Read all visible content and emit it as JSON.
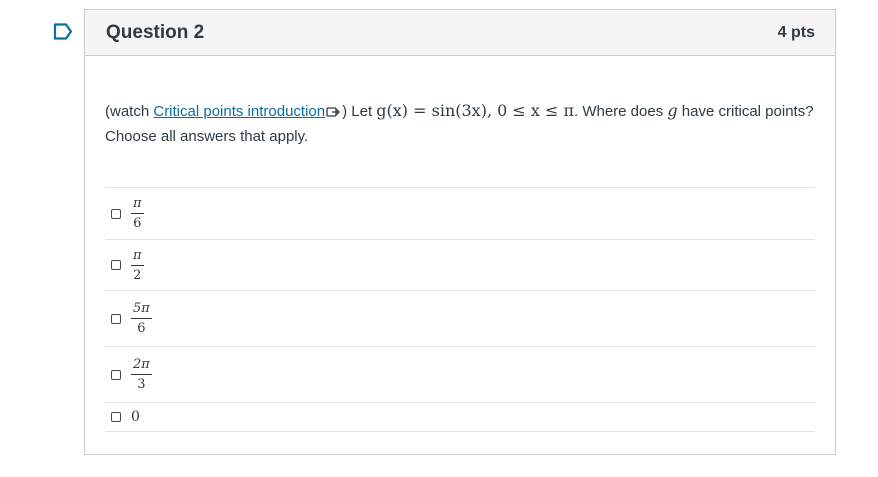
{
  "question": {
    "title": "Question 2",
    "points": "4 pts",
    "prompt_prefix": "(watch ",
    "link_text": "Critical points introduction",
    "prompt_middle": ") Let ",
    "math_expr": "g(x) = sin(3x), 0 ≤ x ≤ π",
    "prompt_after_math": ". Where does ",
    "math_var": "g",
    "prompt_suffix": " have critical points? Choose all answers that apply."
  },
  "answers": [
    {
      "numerator": "π",
      "denominator": "6",
      "checked": false
    },
    {
      "numerator": "π",
      "denominator": "2",
      "checked": false
    },
    {
      "numerator": "5π",
      "denominator": "6",
      "checked": false
    },
    {
      "numerator": "2π",
      "denominator": "3",
      "checked": false
    },
    {
      "plain": "0",
      "checked": false
    }
  ],
  "colors": {
    "link": "#0770a3",
    "flag": "#0770a3",
    "header_bg": "#f5f5f5",
    "border": "#c7cdd1"
  },
  "icons": {
    "flag": "flag-outline-icon",
    "external_video": "external-video-icon"
  }
}
